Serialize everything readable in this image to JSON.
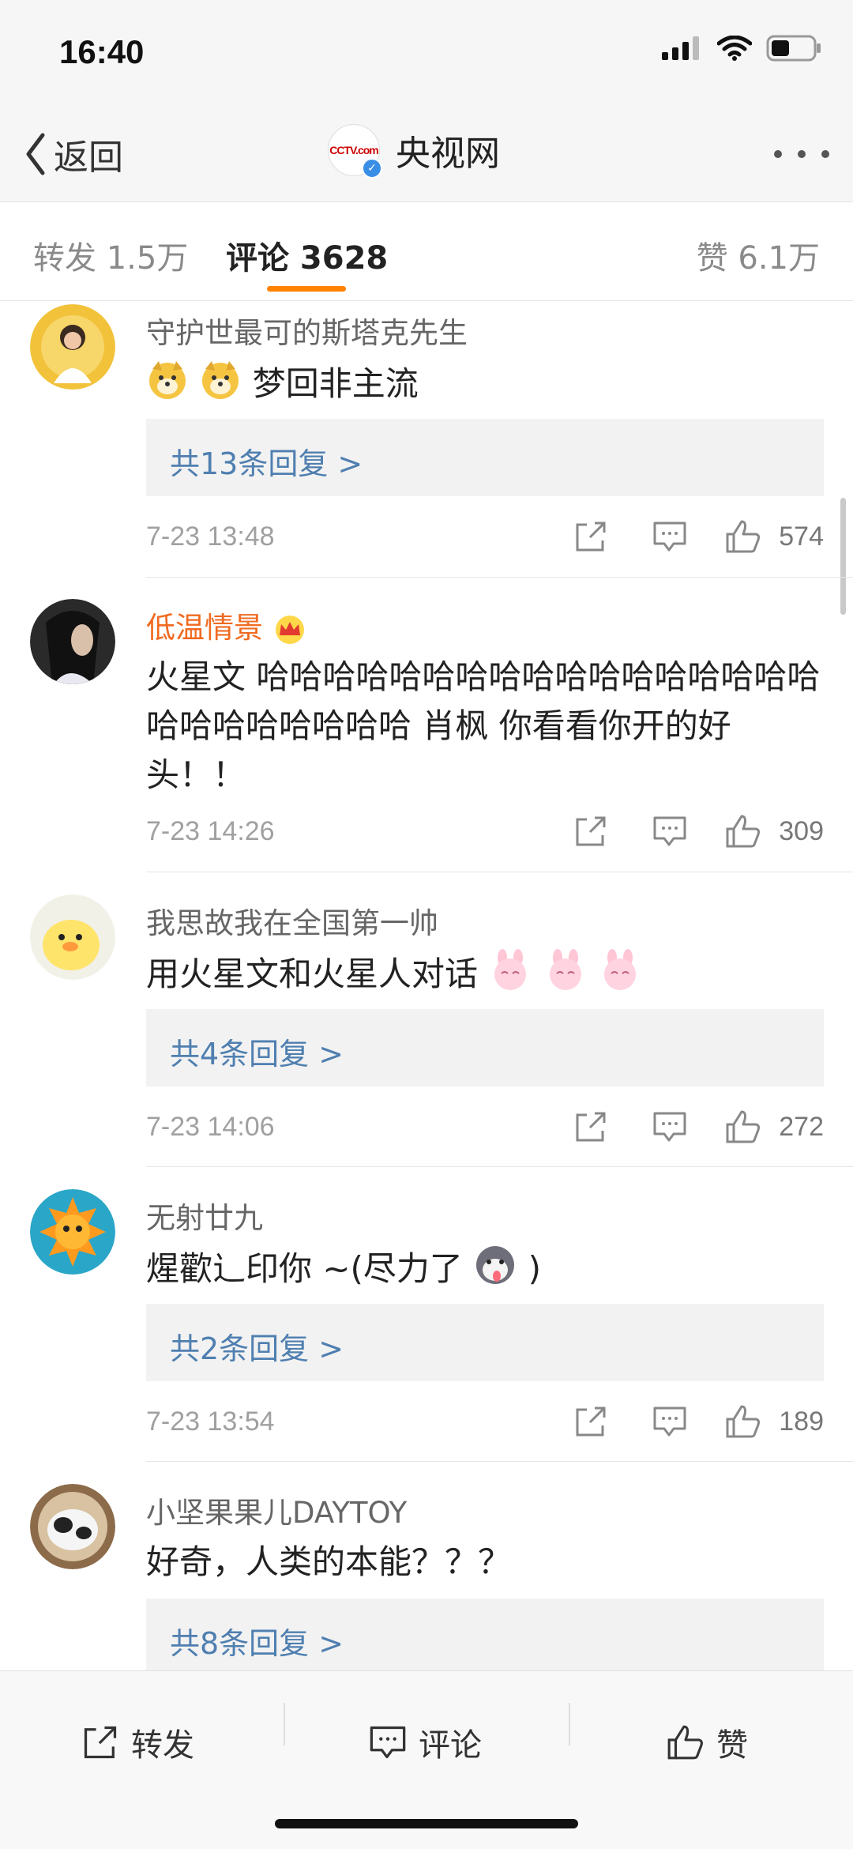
{
  "status_bar": {
    "time": "16:40"
  },
  "nav": {
    "back_label": "返回",
    "title": "央视网",
    "logo_text": "CCTV.com"
  },
  "tabs": {
    "repost": "转发 1.5万",
    "comments": "评论 3628",
    "likes": "赞 6.1万"
  },
  "comments": [
    {
      "username": "守护世最可的斯塔克先生",
      "text": "梦回非主流",
      "replies": "共13条回复 >",
      "time": "7-23 13:48",
      "likes": "574"
    },
    {
      "username": "低温情景",
      "text": "火星文 哈哈哈哈哈哈哈哈哈哈哈哈哈哈哈哈哈哈哈哈哈哈哈哈哈 肖枫 你看看你开的好头！！",
      "time": "7-23 14:26",
      "likes": "309"
    },
    {
      "username": "我思故我在全国第一帅",
      "text": "用火星文和火星人对话",
      "replies": "共4条回复 >",
      "time": "7-23 14:06",
      "likes": "272"
    },
    {
      "username": "无射廿九",
      "text_before": "煋歡辶印你 ~(尽力了",
      "text_after": ")",
      "replies": "共2条回复 >",
      "time": "7-23 13:54",
      "likes": "189"
    },
    {
      "username": "小坚果果儿DAYTOY",
      "text": "好奇，人类的本能？？？",
      "replies": "共8条回复 >"
    }
  ],
  "bottom_bar": {
    "repost": "转发",
    "comment": "评论",
    "like": "赞"
  },
  "colors": {
    "accent": "#ff8200",
    "link": "#4f7fb0",
    "vip_name": "#f06a20"
  }
}
